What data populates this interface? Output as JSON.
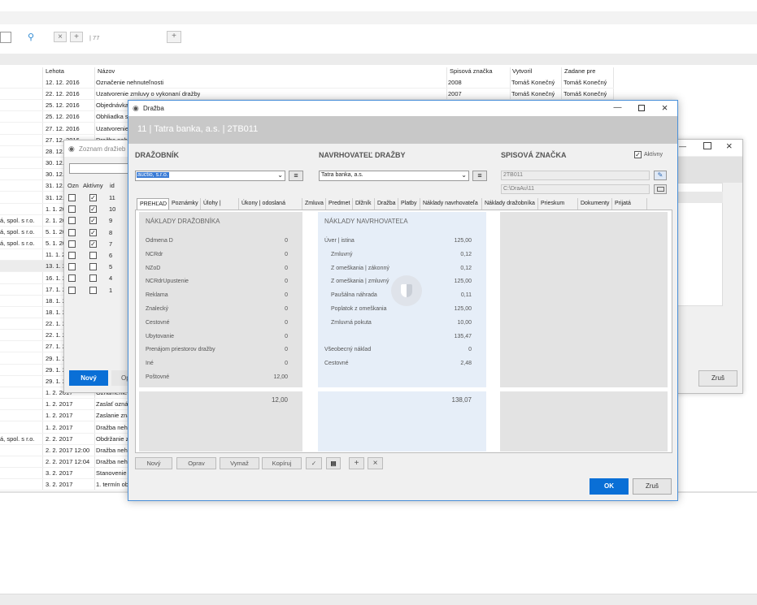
{
  "toolbar": {
    "counter": "| 77",
    "clear_icon": "close-icon",
    "add_icon": "plus-icon",
    "search_icon": "search-icon"
  },
  "grid": {
    "headers": [
      "Lehota",
      "Názov",
      "Spisová značka",
      "Vytvoril",
      "Zadane pre"
    ],
    "rows": [
      {
        "date": "12. 12. 2016",
        "name": "Označenie nehnuteľnosti",
        "file": "2008",
        "created": "Tomáš Konečný",
        "assigned": "Tomáš Konečný",
        "left": ""
      },
      {
        "date": "22. 12. 2016",
        "name": "Uzatvorenie zmluvy o vykonaní dražby",
        "file": "2007",
        "created": "Tomáš Konečný",
        "assigned": "Tomáš Konečný",
        "left": ""
      },
      {
        "date": "25. 12. 2016",
        "name": "Objednávka",
        "file": "",
        "created": "",
        "assigned": "",
        "left": ""
      },
      {
        "date": "25. 12. 2016",
        "name": "Obhliadka sc",
        "file": "",
        "created": "",
        "assigned": "",
        "left": ""
      },
      {
        "date": "27. 12. 2016",
        "name": "Uzatvorenie",
        "file": "",
        "created": "",
        "assigned": "",
        "left": ""
      },
      {
        "date": "27. 12. 2016",
        "name": "Dražba neh",
        "file": "",
        "created": "",
        "assigned": "",
        "left": ""
      },
      {
        "date": "28. 12.",
        "name": "",
        "file": "",
        "created": "",
        "assigned": "",
        "left": ""
      },
      {
        "date": "30. 12.",
        "name": "",
        "file": "",
        "created": "",
        "assigned": "",
        "left": ""
      },
      {
        "date": "30. 12.",
        "name": "",
        "file": "",
        "created": "",
        "assigned": "",
        "left": ""
      },
      {
        "date": "31. 12.",
        "name": "",
        "file": "",
        "created": "",
        "assigned": "",
        "left": ""
      },
      {
        "date": "31. 12.",
        "name": "",
        "file": "",
        "created": "",
        "assigned": "",
        "left": ""
      },
      {
        "date": "1. 1. 20",
        "name": "",
        "file": "",
        "created": "",
        "assigned": "",
        "left": ""
      },
      {
        "date": "2. 1. 20",
        "name": "",
        "file": "",
        "created": "",
        "assigned": "",
        "left": "á, spol. s r.o."
      },
      {
        "date": "5. 1. 20",
        "name": "",
        "file": "",
        "created": "",
        "assigned": "",
        "left": "á, spol. s r.o."
      },
      {
        "date": "5. 1. 20",
        "name": "",
        "file": "",
        "created": "",
        "assigned": "",
        "left": "á, spol. s r.o."
      },
      {
        "date": "11. 1. 2",
        "name": "",
        "file": "",
        "created": "",
        "assigned": "",
        "left": ""
      },
      {
        "date": "13. 1. 2",
        "name": "",
        "file": "",
        "created": "",
        "assigned": "",
        "left": ""
      },
      {
        "date": "16. 1. 2",
        "name": "",
        "file": "",
        "created": "",
        "assigned": "",
        "left": ""
      },
      {
        "date": "17. 1. 2",
        "name": "",
        "file": "",
        "created": "",
        "assigned": "",
        "left": ""
      },
      {
        "date": "18. 1. 2",
        "name": "",
        "file": "",
        "created": "",
        "assigned": "",
        "left": ""
      },
      {
        "date": "18. 1. 2",
        "name": "",
        "file": "",
        "created": "",
        "assigned": "",
        "left": ""
      },
      {
        "date": "22. 1. 2",
        "name": "",
        "file": "",
        "created": "",
        "assigned": "",
        "left": ""
      },
      {
        "date": "22. 1. 2",
        "name": "",
        "file": "",
        "created": "",
        "assigned": "",
        "left": ""
      },
      {
        "date": "27. 1. 2",
        "name": "",
        "file": "",
        "created": "",
        "assigned": "",
        "left": ""
      },
      {
        "date": "29. 1. 2",
        "name": "",
        "file": "",
        "created": "",
        "assigned": "",
        "left": ""
      },
      {
        "date": "29. 1. 2",
        "name": "",
        "file": "",
        "created": "",
        "assigned": "",
        "left": ""
      },
      {
        "date": "29. 1. 2",
        "name": "",
        "file": "",
        "created": "",
        "assigned": "",
        "left": ""
      },
      {
        "date": "1. 2. 2017",
        "name": "Oznámenie",
        "file": "",
        "created": "",
        "assigned": "",
        "left": ""
      },
      {
        "date": "1. 2. 2017",
        "name": "Zaslať oznán",
        "file": "",
        "created": "",
        "assigned": "",
        "left": ""
      },
      {
        "date": "1. 2. 2017",
        "name": "Zaslanie zna",
        "file": "",
        "created": "",
        "assigned": "",
        "left": ""
      },
      {
        "date": "1. 2. 2017",
        "name": "Dražba nehn",
        "file": "",
        "created": "",
        "assigned": "",
        "left": ""
      },
      {
        "date": "2. 2. 2017",
        "name": "Obdržanie zn",
        "file": "",
        "created": "",
        "assigned": "",
        "left": "á, spol. s r.o."
      },
      {
        "date": "2. 2. 2017 12:00",
        "name": "Dražba nehn",
        "file": "",
        "created": "",
        "assigned": "",
        "left": ""
      },
      {
        "date": "2. 2. 2017 12:04",
        "name": "Dražba nehn",
        "file": "",
        "created": "",
        "assigned": "",
        "left": ""
      },
      {
        "date": "3. 2. 2017",
        "name": "Stanovenie t",
        "file": "",
        "created": "",
        "assigned": "",
        "left": ""
      },
      {
        "date": "3. 2. 2017",
        "name": "1. termín obh",
        "file": "",
        "created": "",
        "assigned": "",
        "left": ""
      }
    ]
  },
  "list_window": {
    "title": "Zoznam dražieb",
    "headers": [
      "Ozn",
      "Aktívny",
      "id"
    ],
    "rows": [
      {
        "checked": false,
        "active": true,
        "id": "11"
      },
      {
        "checked": false,
        "active": true,
        "id": "10"
      },
      {
        "checked": false,
        "active": true,
        "id": "9"
      },
      {
        "checked": false,
        "active": true,
        "id": "8"
      },
      {
        "checked": false,
        "active": true,
        "id": "7"
      },
      {
        "checked": false,
        "active": false,
        "id": "6"
      },
      {
        "checked": false,
        "active": false,
        "id": "5"
      },
      {
        "checked": false,
        "active": false,
        "id": "4"
      },
      {
        "checked": false,
        "active": false,
        "id": "1"
      }
    ],
    "new_label": "Nový",
    "edit_label": "Op"
  },
  "right_window": {
    "cancel_label": "Zruš"
  },
  "dialog": {
    "title": "Dražba",
    "header_text": "11 | Tatra banka, a.s. | 2TB011",
    "auctioneer_heading": "DRAŽOBNÍK",
    "auctioneer_value": "auctio, s.r.o.",
    "proposer_heading": "NAVRHOVATEĽ DRAŽBY",
    "proposer_value": "Tatra banka, a.s.",
    "file_heading": "SPISOVÁ ZNAČKA",
    "active_label": "Aktívny",
    "file_value": "2TB011",
    "path_value": "C:\\DraAu\\11",
    "tabs": [
      "PREHĽAD",
      "Poznámky",
      "Úlohy | lehoty",
      "Úkony | odoslaná pošta",
      "Zmluva",
      "Predmet",
      "Dlžník",
      "Dražba",
      "Platby",
      "Náklady navrhovateľa",
      "Náklady dražobníka",
      "Prieskum trhu",
      "Dokumenty",
      "Prijatá pošta"
    ],
    "costs_auctioneer": {
      "title": "NÁKLADY DRAŽOBNÍKA",
      "items": [
        {
          "label": "Odmena D",
          "value": "0"
        },
        {
          "label": "NCRdr",
          "value": "0"
        },
        {
          "label": "NZoD",
          "value": "0"
        },
        {
          "label": "NCRdrUpustenie",
          "value": "0"
        },
        {
          "label": "Reklama",
          "value": "0"
        },
        {
          "label": "Znalecký",
          "value": "0"
        },
        {
          "label": "Cestovné",
          "value": "0"
        },
        {
          "label": "Ubytovanie",
          "value": "0"
        },
        {
          "label": "Prenájom priestorov dražby",
          "value": "0"
        },
        {
          "label": "Iné",
          "value": "0"
        },
        {
          "label": "Poštovné",
          "value": "12,00"
        }
      ],
      "total": "12,00"
    },
    "costs_proposer": {
      "title": "NÁKLADY NAVRHOVATEĽA",
      "items": [
        {
          "label": "Úver | istina",
          "value": "125,00",
          "indent": false
        },
        {
          "label": "Zmluvný",
          "value": "0,12",
          "indent": true
        },
        {
          "label": "Z omeškania | zákonný",
          "value": "0,12",
          "indent": true
        },
        {
          "label": "Z omeškania | zmluvný",
          "value": "125,00",
          "indent": true
        },
        {
          "label": "Paušálna náhrada",
          "value": "0,11",
          "indent": true
        },
        {
          "label": "Poplatok z omeškania",
          "value": "125,00",
          "indent": true
        },
        {
          "label": "Zmluvná pokuta",
          "value": "10,00",
          "indent": true
        },
        {
          "label": "",
          "value": "135,47",
          "indent": false
        },
        {
          "label": "Všeobecný náklad",
          "value": "0",
          "indent": false
        },
        {
          "label": "Cestovné",
          "value": "2,48",
          "indent": false
        }
      ],
      "total": "138,07"
    },
    "bottom_buttons": [
      "Nový",
      "Oprav",
      "Vymaž",
      "Kopíruj"
    ],
    "ok_label": "OK",
    "cancel_label": "Zruš"
  },
  "colors": {
    "accent": "#0a6fd6",
    "header_band": "#c8c8c8",
    "panel_grey": "#e3e3e3",
    "panel_blue": "#e6eef8"
  }
}
